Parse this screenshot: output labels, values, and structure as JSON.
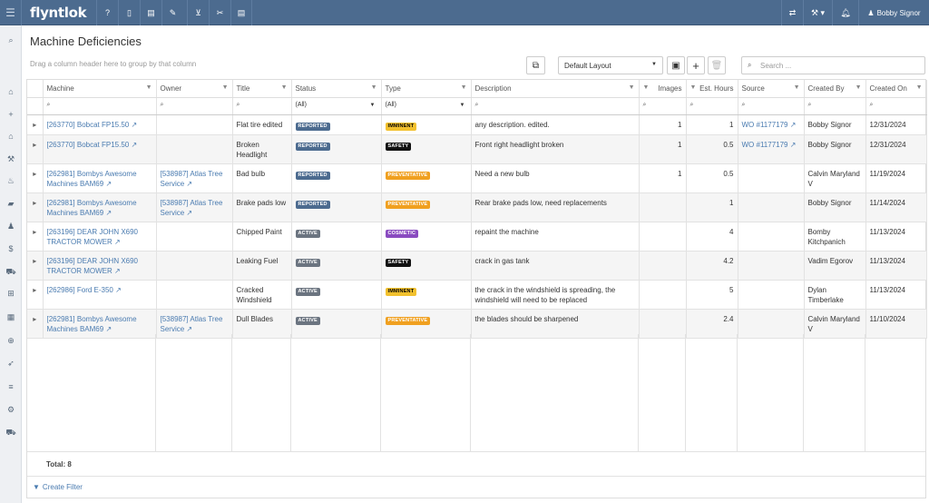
{
  "app": {
    "logo": "flyntlok",
    "user_name": "Bobby Signor"
  },
  "topbar": {
    "menu_icon": "hamburger-icon",
    "nav_icons": [
      "help-icon",
      "mobile-icon",
      "document-icon",
      "edit-document-icon",
      "cart-icon",
      "tools-icon",
      "file-icon"
    ],
    "right_icons": [
      "transfer-icon",
      "wrench-icon",
      "bell-icon",
      "user-icon"
    ]
  },
  "sidebar": {
    "icons": [
      "search-icon",
      "home-icon",
      "plus-icon",
      "bank-icon",
      "wrench-icon",
      "fire-icon",
      "truck-icon",
      "person-icon",
      "dollar-icon",
      "tractor-icon",
      "org-chart-icon",
      "building-icon",
      "target-icon",
      "rocket-icon",
      "list-icon",
      "gear-icon",
      "delivery-truck-icon"
    ]
  },
  "page": {
    "title": "Machine Deficiencies",
    "group_hint": "Drag a column header here to group by that column",
    "layout_selected": "Default Layout",
    "search_placeholder": "Search ..."
  },
  "columns": [
    "Machine",
    "Owner",
    "Title",
    "Status",
    "Type",
    "Description",
    "Images",
    "Est. Hours",
    "Source",
    "Created By",
    "Created On"
  ],
  "filters": {
    "status": "(All)",
    "type": "(All)"
  },
  "colors": {
    "REPORTED": "#4c6b8f",
    "ACTIVE": "#6b7480",
    "IMMINENT": "#f2c12e",
    "SAFETY": "#111111",
    "PREVENTATIVE": "#f0a020",
    "COSMETIC": "#8a4bc0"
  },
  "rows": [
    {
      "machine": "[263770] Bobcat FP15.50",
      "owner": "",
      "title": "Flat tire edited",
      "status": "REPORTED",
      "type": "IMMINENT",
      "description": "any description. edited.",
      "images": "1",
      "hours": "1",
      "source": "WO #1177179",
      "created_by": "Bobby Signor",
      "created_on": "12/31/2024"
    },
    {
      "machine": "[263770] Bobcat FP15.50",
      "owner": "",
      "title": "Broken Headlight",
      "status": "REPORTED",
      "type": "SAFETY",
      "description": "Front right headlight broken",
      "images": "1",
      "hours": "0.5",
      "source": "WO #1177179",
      "created_by": "Bobby Signor",
      "created_on": "12/31/2024"
    },
    {
      "machine": "[262981] Bombys Awesome Machines BAM69",
      "owner": "[538987] Atlas Tree Service",
      "title": "Bad bulb",
      "status": "REPORTED",
      "type": "PREVENTATIVE",
      "description": "Need a new bulb",
      "images": "1",
      "hours": "0.5",
      "source": "",
      "created_by": "Calvin Maryland V",
      "created_on": "11/19/2024"
    },
    {
      "machine": "[262981] Bombys Awesome Machines BAM69",
      "owner": "[538987] Atlas Tree Service",
      "title": "Brake pads low",
      "status": "REPORTED",
      "type": "PREVENTATIVE",
      "description": "Rear brake pads low, need replacements",
      "images": "",
      "hours": "1",
      "source": "",
      "created_by": "Bobby Signor",
      "created_on": "11/14/2024"
    },
    {
      "machine": "[263196] DEAR JOHN X690 TRACTOR MOWER",
      "owner": "",
      "title": "Chipped Paint",
      "status": "ACTIVE",
      "type": "COSMETIC",
      "description": "repaint the machine",
      "images": "",
      "hours": "4",
      "source": "",
      "created_by": "Bomby Kitchpanich",
      "created_on": "11/13/2024"
    },
    {
      "machine": "[263196] DEAR JOHN X690 TRACTOR MOWER",
      "owner": "",
      "title": "Leaking Fuel",
      "status": "ACTIVE",
      "type": "SAFETY",
      "description": "crack in gas tank",
      "images": "",
      "hours": "4.2",
      "source": "",
      "created_by": "Vadim Egorov",
      "created_on": "11/13/2024"
    },
    {
      "machine": "[262986] Ford E-350",
      "owner": "",
      "title": "Cracked Windshield",
      "status": "ACTIVE",
      "type": "IMMINENT",
      "description": "the crack in the windshield is spreading, the windshield will need to be replaced",
      "images": "",
      "hours": "5",
      "source": "",
      "created_by": "Dylan Timberlake",
      "created_on": "11/13/2024"
    },
    {
      "machine": "[262981] Bombys Awesome Machines BAM69",
      "owner": "[538987] Atlas Tree Service",
      "title": "Dull Blades",
      "status": "ACTIVE",
      "type": "PREVENTATIVE",
      "description": "the blades should be sharpened",
      "images": "",
      "hours": "2.4",
      "source": "",
      "created_by": "Calvin Maryland V",
      "created_on": "11/10/2024"
    }
  ],
  "footer": {
    "total": "Total: 8",
    "create_filter": "Create Filter"
  }
}
